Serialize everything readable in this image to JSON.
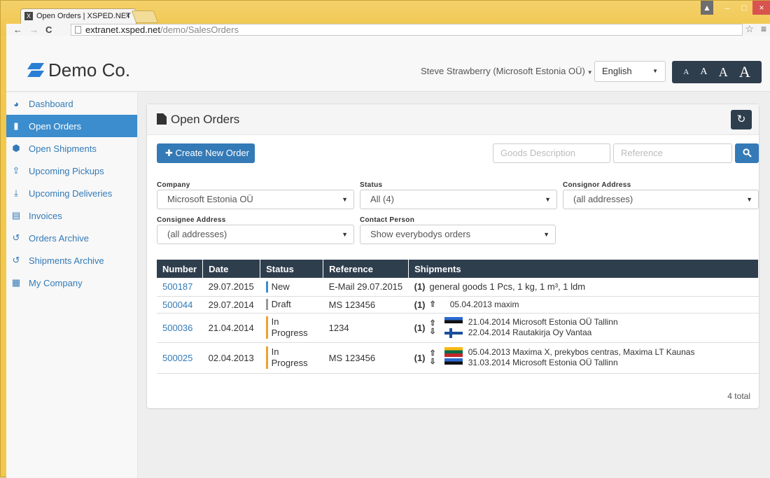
{
  "browser": {
    "tab_title": "Open Orders | XSPED.NET",
    "tab_close": "×",
    "favicon": "X",
    "url_host": "extranet.xsped.net",
    "url_path": "/demo/SalesOrders"
  },
  "header": {
    "logo_text": "Demo Co.",
    "user_name": "Steve Strawberry (Microsoft Estonia OÜ)",
    "language": "English",
    "font_sizes": [
      "A",
      "A",
      "A",
      "A"
    ]
  },
  "sidebar": {
    "items": [
      {
        "label": "Dashboard",
        "icon": "dashboard-icon",
        "glyph": "◕"
      },
      {
        "label": "Open Orders",
        "icon": "document-icon",
        "glyph": "▮",
        "active": true
      },
      {
        "label": "Open Shipments",
        "icon": "cube-icon",
        "glyph": "⬢"
      },
      {
        "label": "Upcoming Pickups",
        "icon": "upload-icon",
        "glyph": "⇪"
      },
      {
        "label": "Upcoming Deliveries",
        "icon": "download-icon",
        "glyph": "⤓"
      },
      {
        "label": "Invoices",
        "icon": "pdf-icon",
        "glyph": "▤"
      },
      {
        "label": "Orders Archive",
        "icon": "history-icon",
        "glyph": "↺"
      },
      {
        "label": "Shipments Archive",
        "icon": "history-icon",
        "glyph": "↺"
      },
      {
        "label": "My Company",
        "icon": "building-icon",
        "glyph": "▦"
      }
    ]
  },
  "panel": {
    "title": "Open Orders",
    "create_button": "Create New Order",
    "goods_placeholder": "Goods Description",
    "reference_placeholder": "Reference"
  },
  "filters": {
    "company_label": "Company",
    "company_value": "Microsoft Estonia OÜ",
    "status_label": "Status",
    "status_value": "All (4)",
    "consignor_label": "Consignor Address",
    "consignor_value": "(all addresses)",
    "consignee_label": "Consignee Address",
    "consignee_value": "(all addresses)",
    "contact_label": "Contact Person",
    "contact_value": "Show everybodys orders"
  },
  "table": {
    "headers": [
      "Number",
      "Date",
      "Status",
      "Reference",
      "Shipments"
    ],
    "rows": [
      {
        "number": "500187",
        "date": "29.07.2015",
        "status": "New",
        "status_color": "#3c8dcd",
        "reference": "E-Mail 29.07.2015",
        "count": "(1)",
        "summary": "general goods 1 Pcs, 1 kg, 1 m³, 1 ldm"
      },
      {
        "number": "500044",
        "date": "29.07.2014",
        "status": "Draft",
        "status_color": "#999999",
        "reference": "MS 123456",
        "count": "(1)",
        "line1": "05.04.2013 maxim"
      },
      {
        "number": "500036",
        "date": "21.04.2014",
        "status": "In Progress",
        "status_color": "#f0a030",
        "reference": "1234",
        "count": "(1)",
        "line1": "21.04.2014 Microsoft Estonia OÜ Tallinn",
        "line2": "22.04.2014 Rautakirja Oy Vantaa"
      },
      {
        "number": "500025",
        "date": "02.04.2013",
        "status": "In Progress",
        "status_color": "#f0a030",
        "reference": "MS 123456",
        "count": "(1)",
        "line1": "05.04.2013 Maxima X, prekybos centras, Maxima LT Kaunas",
        "line2": "31.03.2014 Microsoft Estonia OÜ Tallinn"
      }
    ],
    "total": "4 total"
  }
}
